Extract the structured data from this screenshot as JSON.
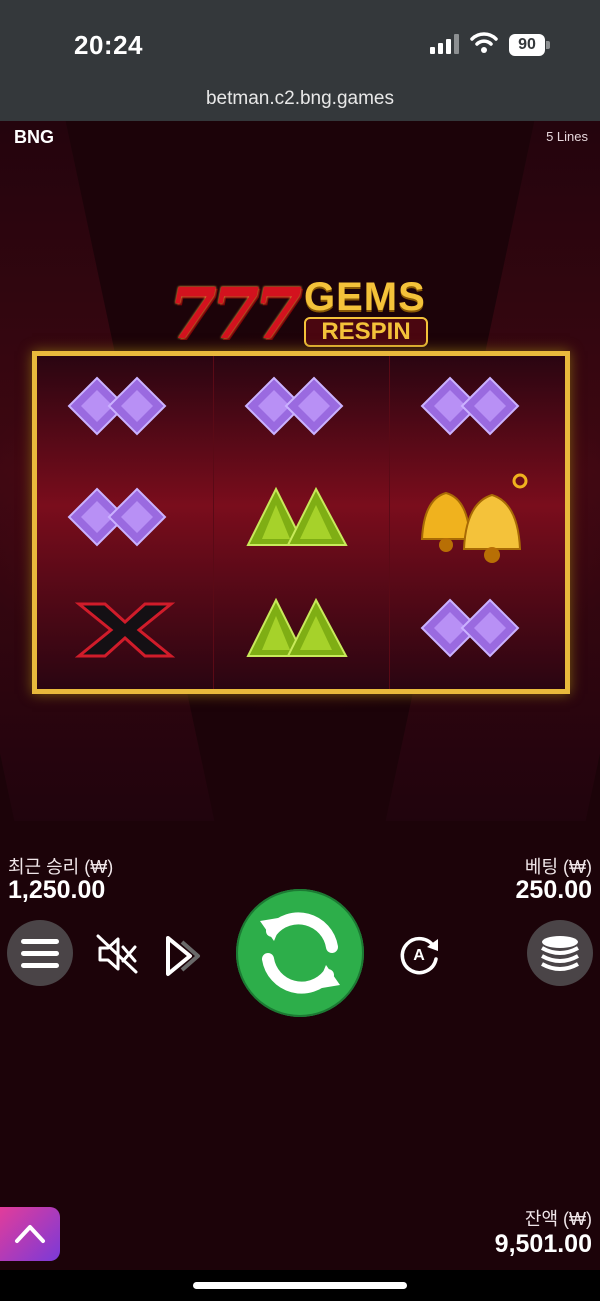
{
  "status_bar": {
    "time": "20:24",
    "battery": "90",
    "url": "betman.c2.bng.games"
  },
  "game": {
    "brand": "BNG",
    "lines": "5 Lines",
    "logo": {
      "sevens": "777",
      "word1": "GEMS",
      "word2": "RESPIN"
    },
    "reels": [
      [
        "purple-gem-icon",
        "purple-gem-icon",
        "x-icon"
      ],
      [
        "purple-gem-icon",
        "green-gem-icon",
        "green-gem-icon"
      ],
      [
        "purple-gem-icon",
        "bell-icon",
        "purple-gem-icon"
      ]
    ],
    "last_win_label": "최근 승리 (₩)",
    "last_win_value": "1,250.00",
    "bet_label": "베팅 (₩)",
    "bet_value": "250.00",
    "balance_label": "잔액 (₩)",
    "balance_value": "9,501.00"
  },
  "colors": {
    "spin": "#2dae4a",
    "frame": "#e9b93c",
    "gem_purple": "#9a6ae0",
    "gem_green": "#8ec21a",
    "bell": "#f0b21e"
  }
}
